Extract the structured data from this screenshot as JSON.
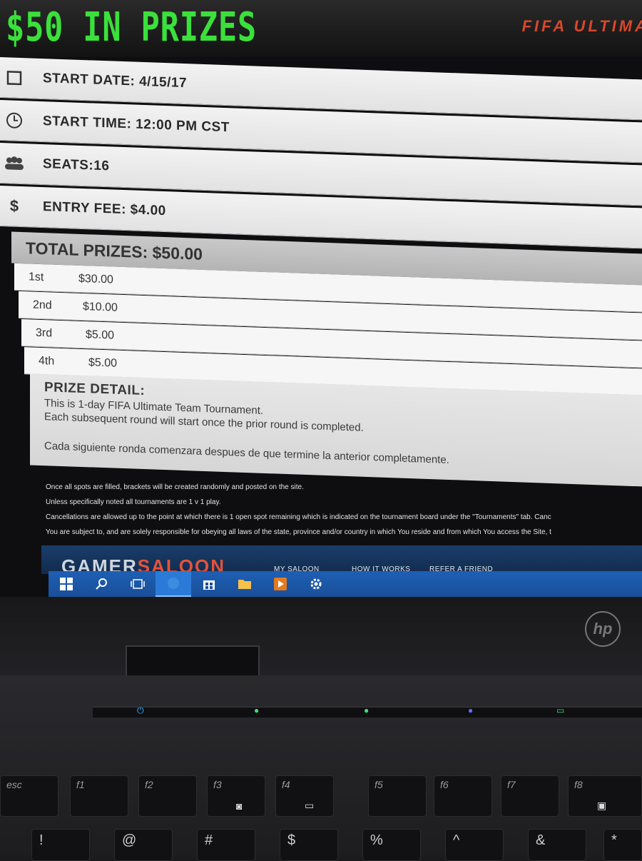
{
  "banner": {
    "headline": "$50 IN PRIZES",
    "game_tag": "FIFA ULTIMA"
  },
  "info_rows": [
    {
      "icon": "calendar-icon",
      "label": "START DATE: 4/15/17"
    },
    {
      "icon": "clock-icon",
      "label": "START TIME: 12:00 PM CST"
    },
    {
      "icon": "people-icon",
      "label": "SEATS:16"
    },
    {
      "icon": "dollar-icon",
      "icon_text": "$",
      "label": "ENTRY FEE: $4.00"
    }
  ],
  "total_prizes": "TOTAL PRIZES: $50.00",
  "places": [
    {
      "place": "1st",
      "amount": "$30.00"
    },
    {
      "place": "2nd",
      "amount": "$10.00"
    },
    {
      "place": "3rd",
      "amount": "$5.00"
    },
    {
      "place": "4th",
      "amount": "$5.00"
    }
  ],
  "prize_detail": {
    "title": "PRIZE DETAIL:",
    "line1": "This is 1-day FIFA Ultimate Team Tournament.",
    "line2": "Each subsequent round will start once the prior round is completed.",
    "line3": "Cada siguiente ronda comenzara despues de que termine la anterior completamente."
  },
  "notes": [
    "Once all spots are filled, brackets will be created randomly and posted on the site.",
    "Unless specifically noted all tournaments are 1 v 1 play.",
    "Cancellations are allowed up to the point at which there is 1 open spot remaining which is indicated on the tournament board under the \"Tournaments\" tab. Canc",
    "You are subject to, and are solely responsible for obeying all laws of the state, province and/or country in which You reside and from which You access the Site, t"
  ],
  "footer_nav": {
    "brand_main": "GAMER",
    "brand_accent": "SALOON",
    "links": [
      "MY SALOON",
      "HOW IT WORKS",
      "REFER A FRIEND"
    ]
  },
  "taskbar": [
    "windows-start-icon",
    "search-icon",
    "task-view-icon",
    "browser-icon",
    "store-icon",
    "file-explorer-icon",
    "media-player-icon",
    "settings-icon"
  ],
  "laptop": {
    "brand": "hp",
    "fkeys": [
      {
        "label": "esc",
        "glyph": ""
      },
      {
        "label": "f1",
        "glyph": ""
      },
      {
        "label": "f2",
        "glyph": ""
      },
      {
        "label": "f3",
        "glyph": "◙"
      },
      {
        "label": "f4",
        "glyph": "▭"
      },
      {
        "label": "f5",
        "glyph": ""
      },
      {
        "label": "f6",
        "glyph": ""
      },
      {
        "label": "f7",
        "glyph": ""
      },
      {
        "label": "f8",
        "glyph": "▣"
      }
    ],
    "number_keys": [
      "!",
      "@",
      "#",
      "$",
      "%",
      "^",
      "&",
      "*"
    ],
    "colors": {
      "accent_green": "#3be03b",
      "taskbar_blue": "#1e5fb5",
      "brand_orange": "#e2533a"
    }
  }
}
